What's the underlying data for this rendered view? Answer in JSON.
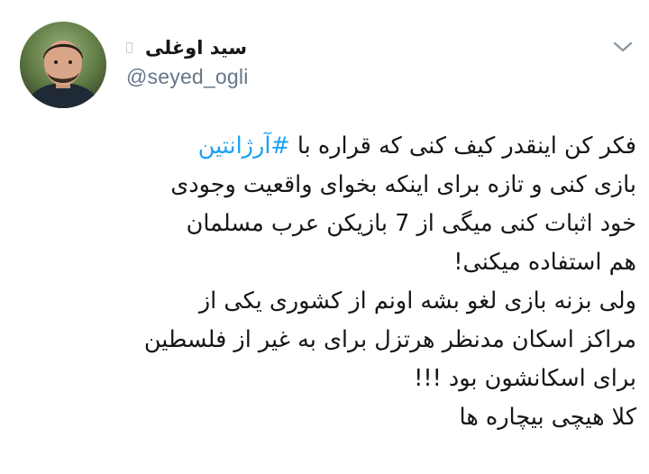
{
  "author": {
    "display_name": "سید اوغلی",
    "handle": "@seyed_ogli",
    "avatar_icon": "profile-photo",
    "lock_icon": "protected-account-icon"
  },
  "menu": {
    "icon": "chevron-down-icon"
  },
  "tweet": {
    "lines": [
      {
        "prefix": "فکر کن اینقدر کیف کنی که قراره با ",
        "hashtag": "#آرژانتین"
      },
      {
        "text": "بازی کنی و تازه برای اینکه بخوای واقعیت وجودی"
      },
      {
        "text": "خود اثبات کنی میگی از 7 بازیکن عرب مسلمان"
      },
      {
        "text": "هم استفاده میکنی!"
      },
      {
        "text": "ولی بزنه بازی لغو بشه اونم از کشوری یکی از"
      },
      {
        "text": "مراکز اسکان مدنظر هرتزل برای به غیر از فلسطین"
      },
      {
        "text": "برای اسکانشون بود !!!"
      },
      {
        "text": "کلا هیچی بیچاره ها"
      }
    ]
  },
  "colors": {
    "text": "#14171a",
    "secondary": "#657786",
    "link": "#1da1f2"
  }
}
